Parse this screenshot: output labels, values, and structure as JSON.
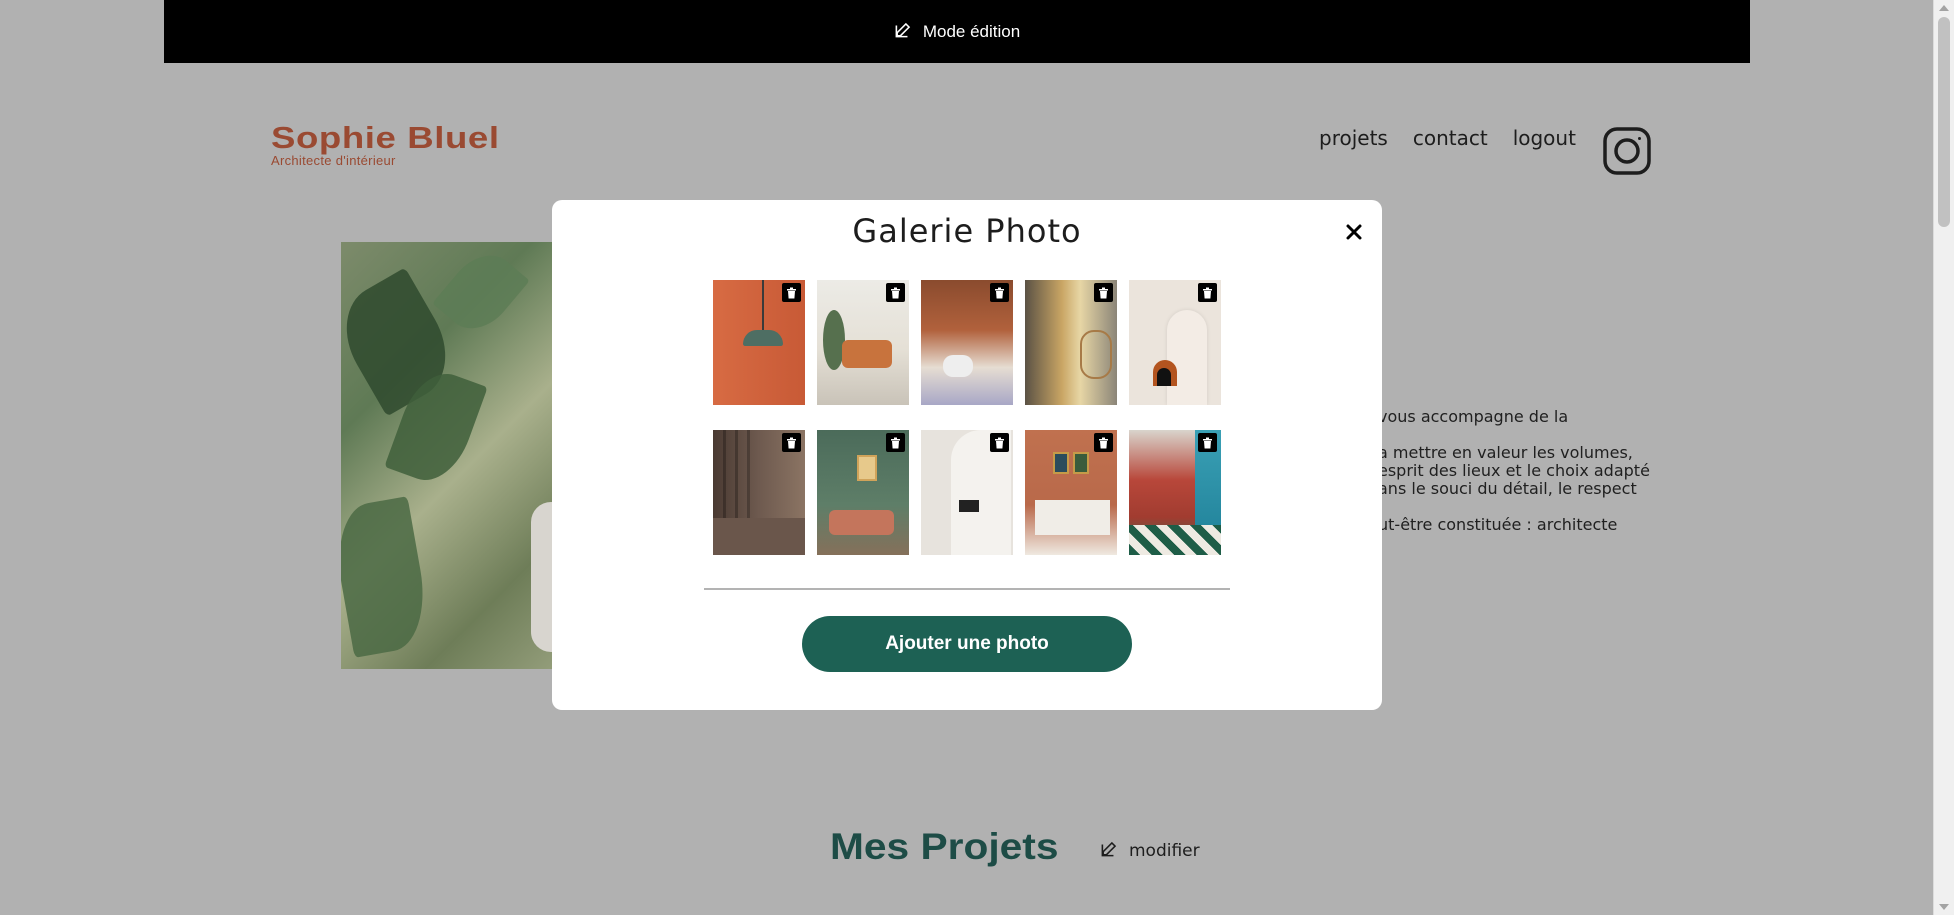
{
  "edit_bar": {
    "label": "Mode édition"
  },
  "header": {
    "logo_name": "Sophie Bluel",
    "logo_subtitle": "Architecte d'intérieur",
    "nav": [
      "projets",
      "contact",
      "logout"
    ],
    "instagram_icon": "instagram-icon"
  },
  "intro": {
    "paragraphs": [
      "vous accompagne de la",
      "a mettre en valeur les volumes, esprit des lieux et le choix adapté ans le souci du détail, le respect",
      "ut-être constituée : architecte"
    ]
  },
  "projects": {
    "title": "Mes Projets",
    "modify_label": "modifier"
  },
  "modal": {
    "title": "Galerie Photo",
    "close_label": "×",
    "add_button": "Ajouter une photo",
    "photo_count": 10
  },
  "colors": {
    "brand": "#9a4a32",
    "accent": "#1d6154",
    "overlay_bg": "#b1b1b1",
    "edit_bar_bg": "#000000"
  }
}
